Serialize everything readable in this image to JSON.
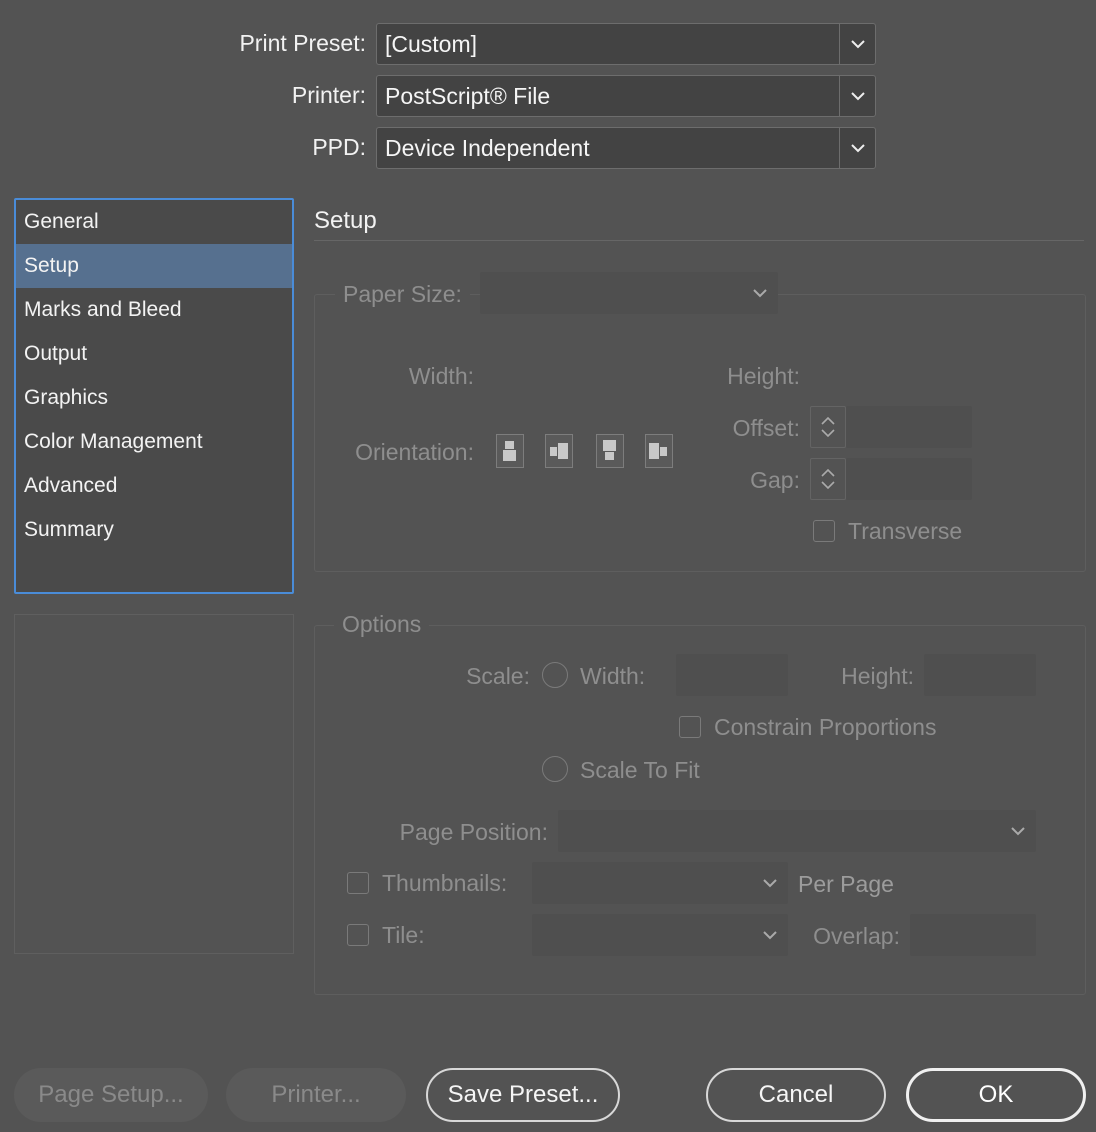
{
  "top": {
    "print_preset_label": "Print Preset:",
    "print_preset_value": "[Custom]",
    "printer_label": "Printer:",
    "printer_value": "PostScript® File",
    "ppd_label": "PPD:",
    "ppd_value": "Device Independent"
  },
  "sidebar": {
    "items": [
      {
        "label": "General"
      },
      {
        "label": "Setup"
      },
      {
        "label": "Marks and Bleed"
      },
      {
        "label": "Output"
      },
      {
        "label": "Graphics"
      },
      {
        "label": "Color Management"
      },
      {
        "label": "Advanced"
      },
      {
        "label": "Summary"
      }
    ],
    "selected": "Setup"
  },
  "setup": {
    "title": "Setup",
    "paper_size_label": "Paper Size:",
    "width_label": "Width:",
    "height_label": "Height:",
    "offset_label": "Offset:",
    "orientation_label": "Orientation:",
    "gap_label": "Gap:",
    "transverse_label": "Transverse"
  },
  "options": {
    "title": "Options",
    "scale_label": "Scale:",
    "width_label": "Width:",
    "height_label": "Height:",
    "constrain_label": "Constrain Proportions",
    "scale_to_fit_label": "Scale To Fit",
    "page_position_label": "Page Position:",
    "thumbnails_label": "Thumbnails:",
    "per_page_label": "Per Page",
    "tile_label": "Tile:",
    "overlap_label": "Overlap:"
  },
  "buttons": {
    "page_setup": "Page Setup...",
    "printer": "Printer...",
    "save_preset": "Save Preset...",
    "cancel": "Cancel",
    "ok": "OK"
  },
  "icons": {
    "dropdown": "chevron-down-icon",
    "spinner_up": "chevron-up-icon",
    "spinner_down": "chevron-down-icon",
    "orientation": [
      "portrait-icon",
      "landscape-icon",
      "reverse-portrait-icon",
      "reverse-landscape-icon"
    ]
  },
  "colors": {
    "background": "#535353",
    "selection": "#56708f",
    "focus_border": "#4a8cd8"
  }
}
